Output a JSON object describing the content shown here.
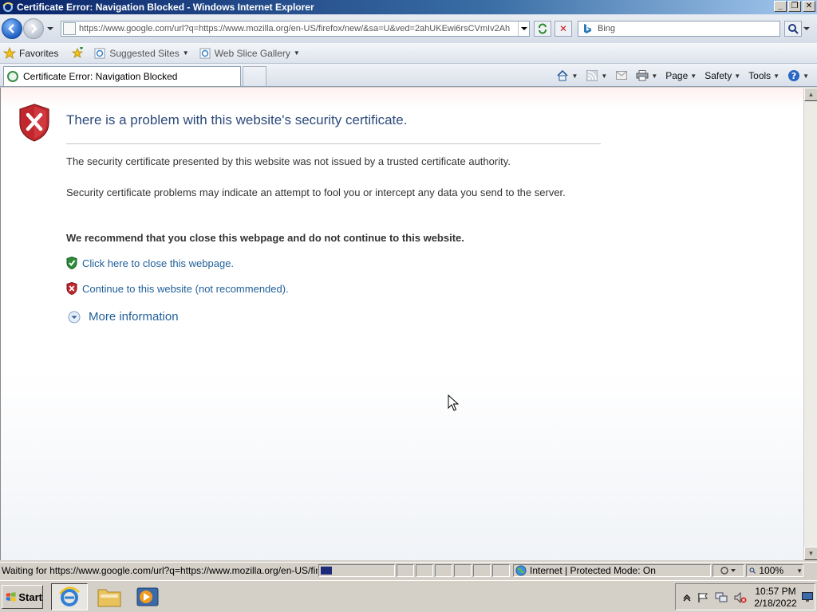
{
  "window": {
    "title": "Certificate Error: Navigation Blocked - Windows Internet Explorer"
  },
  "address_bar": {
    "url": "https://www.google.com/url?q=https://www.mozilla.org/en-US/firefox/new/&sa=U&ved=2ahUKEwi6rsCVmIv2Ah",
    "search_placeholder": "Bing"
  },
  "favorites_bar": {
    "favorites_label": "Favorites",
    "items": [
      {
        "label": "Suggested Sites"
      },
      {
        "label": "Web Slice Gallery"
      }
    ]
  },
  "tabs": [
    {
      "title": "Certificate Error: Navigation Blocked"
    }
  ],
  "command_bar": {
    "page_label": "Page",
    "safety_label": "Safety",
    "tools_label": "Tools"
  },
  "page": {
    "title": "There is a problem with this website's security certificate.",
    "para1": "The security certificate presented by this website was not issued by a trusted certificate authority.",
    "para2": "Security certificate problems may indicate an attempt to fool you or intercept any data you send to the server.",
    "recommendation": "We recommend that you close this webpage and do not continue to this website.",
    "close_link": "Click here to close this webpage.",
    "continue_link": "Continue to this website (not recommended).",
    "more_info": "More information"
  },
  "status_bar": {
    "status_text": "Waiting for https://www.google.com/url?q=https://www.mozilla.org/en-US/firefox/new/&sa=U",
    "progress": 0.15,
    "zone_text": "Internet | Protected Mode: On",
    "zoom": "100%"
  },
  "taskbar": {
    "start_label": "Start",
    "clock_time": "10:57 PM",
    "clock_date": "2/18/2022"
  },
  "colors": {
    "link": "#1f5f99",
    "title_text": "#2c4a7a",
    "error_red": "#c0282d"
  }
}
